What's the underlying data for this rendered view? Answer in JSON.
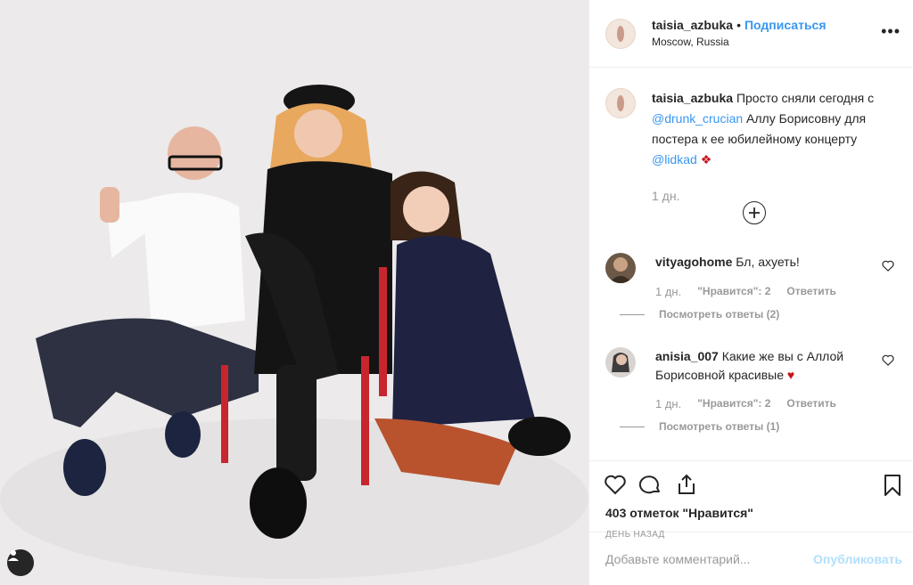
{
  "header": {
    "username": "taisia_azbuka",
    "separator": "•",
    "follow_label": "Подписаться",
    "location": "Moscow, Russia",
    "more_glyph": "•••"
  },
  "caption": {
    "username": "taisia_azbuka",
    "text_1": "Просто сняли сегодня с",
    "mention_1": "@drunk_crucian",
    "text_2": "Аллу Борисовну для постера к ее юбилейному концерту",
    "mention_2": "@lidkad",
    "emoji": "❖",
    "time": "1 дн."
  },
  "comments": [
    {
      "username": "vityagohome",
      "text": "Бл, ахуеть!",
      "time": "1 дн.",
      "likes_label": "\"Нравится\": 2",
      "reply_label": "Ответить",
      "view_replies": "Посмотреть ответы (2)"
    },
    {
      "username": "anisia_007",
      "text": "Какие же вы с Аллой Борисовной красивые",
      "emoji": "♥",
      "time": "1 дн.",
      "likes_label": "\"Нравится\": 2",
      "reply_label": "Ответить",
      "view_replies": "Посмотреть ответы (1)"
    }
  ],
  "actions": {
    "icons": [
      "heart-icon",
      "comment-icon",
      "share-icon",
      "bookmark-icon"
    ],
    "likes_text": "403 отметок \"Нравится\"",
    "posted": "ДЕНЬ НАЗАД"
  },
  "add_comment": {
    "placeholder": "Добавьте комментарий...",
    "publish_label": "Опубликовать"
  },
  "colors": {
    "link": "#3897f0",
    "muted": "#999999",
    "publish_disabled": "#b2dffc",
    "heart_red": "#c4151c"
  }
}
